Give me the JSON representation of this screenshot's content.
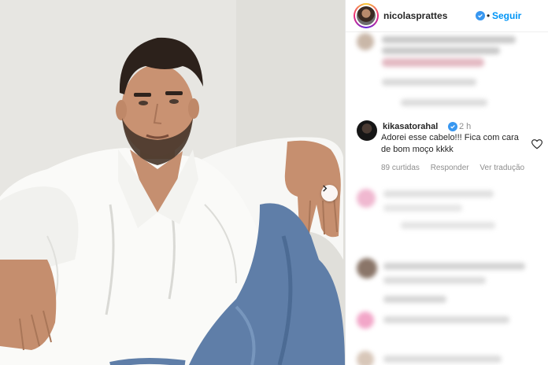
{
  "post": {
    "username": "nicolasprattes",
    "dot": "•",
    "follow_label": "Seguir"
  },
  "comment": {
    "username": "kikasatorahal",
    "time": "2 h",
    "text": "Adorei esse cabelo!!! Fica com cara de bom moço kkkk",
    "likes": "89 curtidas",
    "reply_label": "Responder",
    "translate_label": "Ver tradução"
  },
  "colors": {
    "follow_blue": "#0095f6",
    "verified_blue": "#3897f0",
    "text_primary": "#262626",
    "text_secondary": "#8e8e8e"
  },
  "icons": [
    "verified-badge-icon",
    "heart-icon",
    "chevron-right-icon"
  ]
}
